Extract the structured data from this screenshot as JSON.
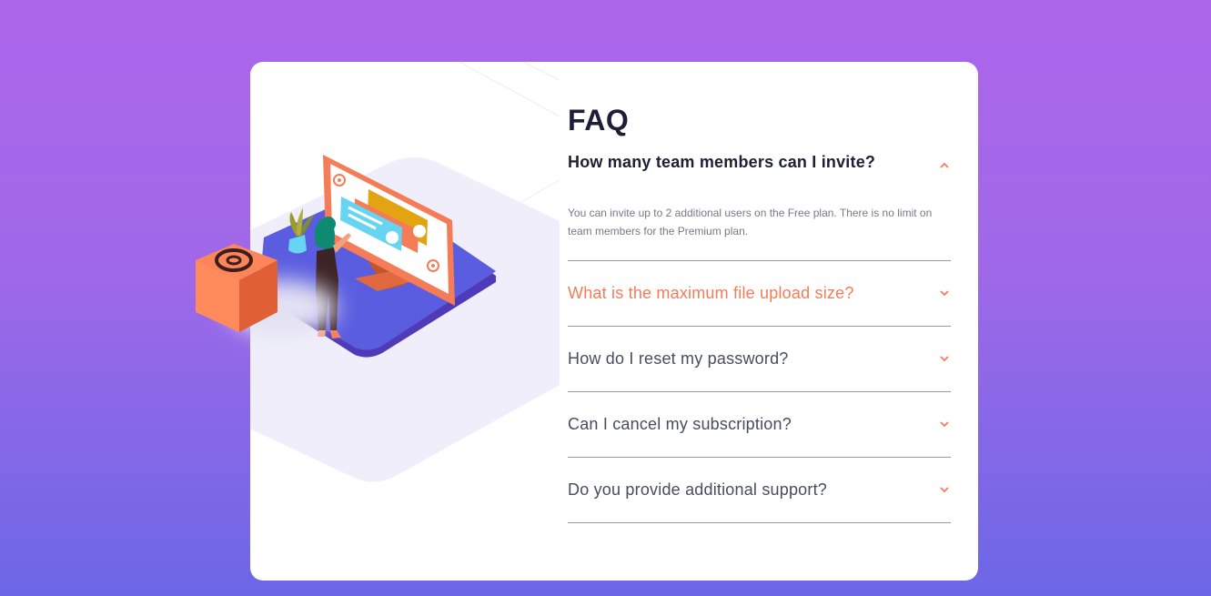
{
  "page": {
    "background_top": "#ad66ea",
    "background_bottom": "#6c67e6",
    "accent": "#f47c57",
    "title_color": "#1e1f36"
  },
  "illustration": {
    "icon": "woman-online-desktop-illustration",
    "box_icon": "at-sign-icon"
  },
  "faq": {
    "title": "FAQ",
    "items": [
      {
        "question": "How many team members can I invite?",
        "answer": "You can invite up to 2 additional users on the Free plan. There is no limit on team members for the Premium plan.",
        "state": "open",
        "icon": "chevron-up-icon"
      },
      {
        "question": "What is the maximum file upload size?",
        "state": "hover",
        "icon": "chevron-down-icon"
      },
      {
        "question": "How do I reset my password?",
        "state": "closed",
        "icon": "chevron-down-icon"
      },
      {
        "question": "Can I cancel my subscription?",
        "state": "closed",
        "icon": "chevron-down-icon"
      },
      {
        "question": "Do you provide additional support?",
        "state": "closed",
        "icon": "chevron-down-icon"
      }
    ]
  }
}
